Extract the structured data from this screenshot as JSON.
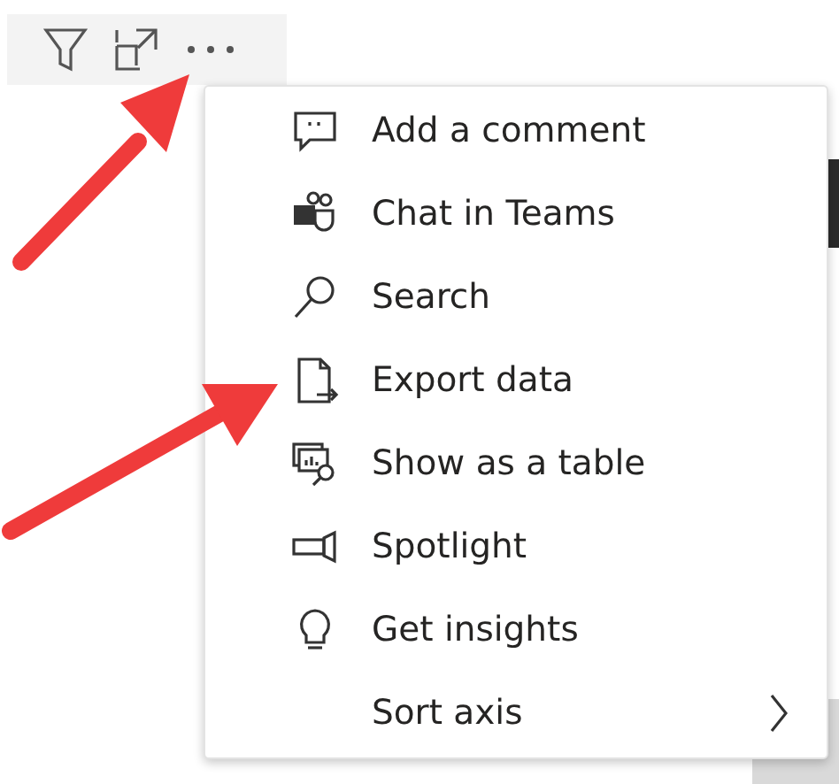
{
  "menu": {
    "items": [
      {
        "kind": "action",
        "label": "Add a comment"
      },
      {
        "kind": "action",
        "label": "Chat in Teams"
      },
      {
        "kind": "action",
        "label": "Search"
      },
      {
        "kind": "action",
        "label": "Export data"
      },
      {
        "kind": "action",
        "label": "Show as a table"
      },
      {
        "kind": "action",
        "label": "Spotlight"
      },
      {
        "kind": "action",
        "label": "Get insights"
      },
      {
        "kind": "submenu",
        "label": "Sort axis"
      }
    ]
  }
}
